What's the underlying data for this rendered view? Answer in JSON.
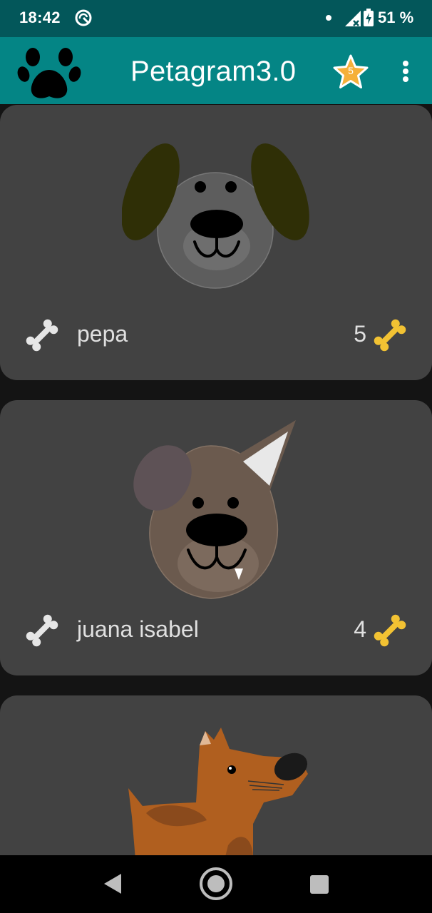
{
  "status_bar": {
    "time": "18:42",
    "battery": "51 %"
  },
  "app_bar": {
    "title": "Petagram3.0",
    "favorites_count": "5",
    "logo": "paw-print-icon",
    "favorites_icon": "star-icon",
    "overflow_icon": "more-vert-icon"
  },
  "pets": [
    {
      "name": "pepa",
      "rating": "5",
      "like_icon": "bone-white-icon",
      "rating_icon": "bone-gold-icon"
    },
    {
      "name": "juana isabel",
      "rating": "4",
      "like_icon": "bone-white-icon",
      "rating_icon": "bone-gold-icon"
    }
  ],
  "nav_bar": {
    "back_icon": "back-triangle-icon",
    "home_icon": "home-circle-icon",
    "recents_icon": "recents-square-icon"
  },
  "colors": {
    "status_bar": "#03575a",
    "app_bar": "#048585",
    "card": "#424242",
    "background": "#141414"
  }
}
